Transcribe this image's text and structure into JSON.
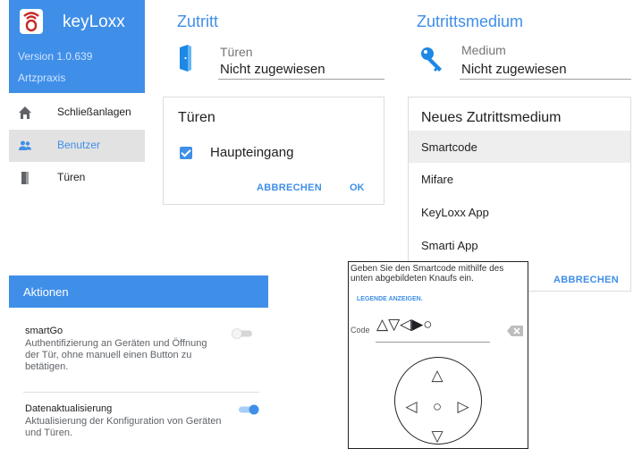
{
  "sidebar": {
    "app_title": "keyLoxx",
    "version": "Version 1.0.639",
    "organization": "Artzpraxis",
    "items": [
      {
        "label": "Schließanlagen",
        "icon": "home-icon"
      },
      {
        "label": "Benutzer",
        "icon": "users-icon"
      },
      {
        "label": "Türen",
        "icon": "door-icon"
      }
    ],
    "accent_color": "#3f8fe8"
  },
  "zutritt": {
    "title": "Zutritt",
    "field_label": "Türen",
    "field_value": "Nicht zugewiesen"
  },
  "doors_dialog": {
    "title": "Türen",
    "items": [
      {
        "label": "Haupteingang",
        "checked": true
      }
    ],
    "cancel_label": "ABBRECHEN",
    "ok_label": "OK"
  },
  "zutrittsmedium": {
    "title": "Zutrittsmedium",
    "field_label": "Medium",
    "field_value": "Nicht zugewiesen"
  },
  "medium_dialog": {
    "title": "Neues Zutrittsmedium",
    "options": [
      "Smartcode",
      "Mifare",
      "KeyLoxx App",
      "Smarti App"
    ],
    "cancel_label": "ABBRECHEN"
  },
  "actions": {
    "header": "Aktionen",
    "items": [
      {
        "title": "smartGo",
        "description": "Authentifizierung an Geräten und Öffnung der Tür, ohne manuell einen Button zu betätigen.",
        "enabled": false
      },
      {
        "title": "Datenaktualisierung",
        "description": "Aktualisierung der Konfiguration von Geräten und Türen.",
        "enabled": true
      }
    ]
  },
  "smartcode": {
    "instruction": "Geben Sie den Smartcode mithilfe des unten abgebildeten Knaufs ein.",
    "legend_link": "LEGENDE ANZEIGEN.",
    "code_label": "Code",
    "code_value": "△▽◁▶○",
    "knob": {
      "up": "△",
      "left": "◁",
      "center": "○",
      "right": "▷",
      "down": "▽"
    }
  }
}
